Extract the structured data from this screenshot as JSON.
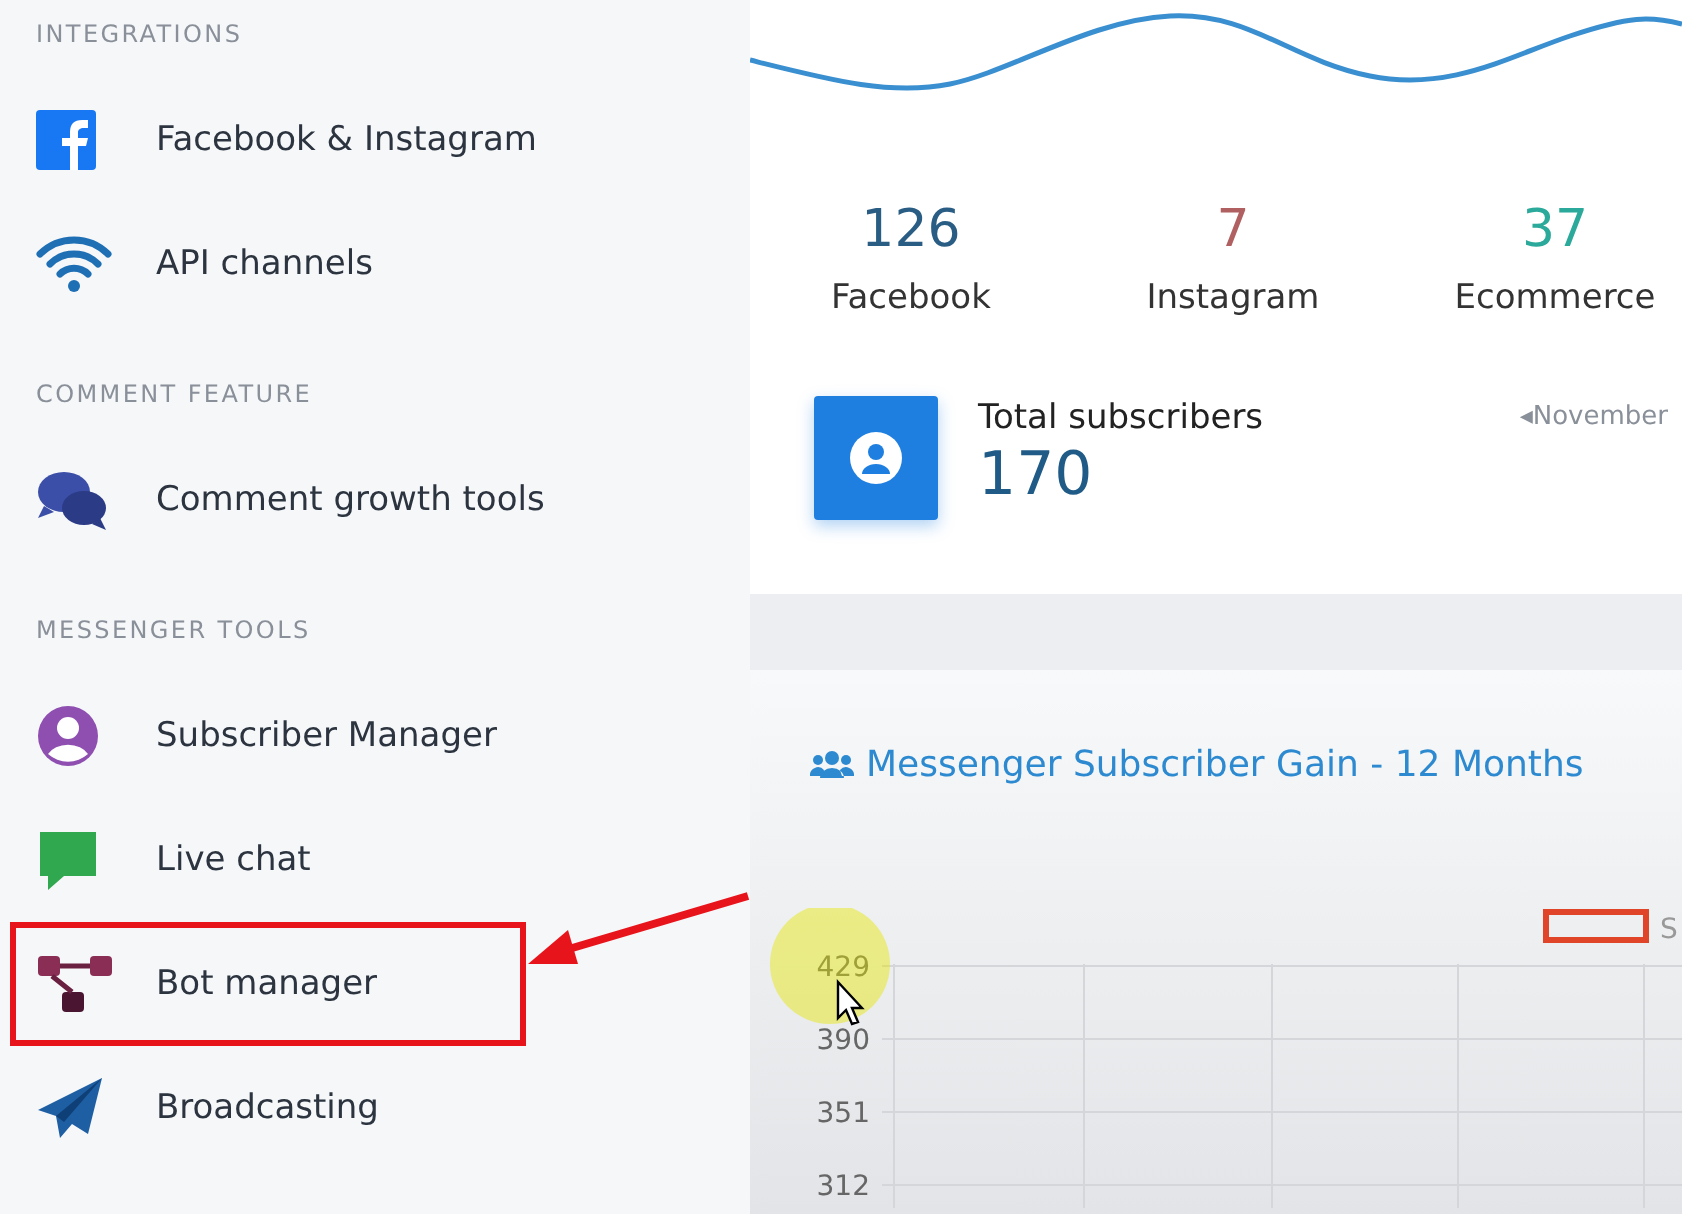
{
  "sidebar": {
    "sections": [
      {
        "title": "INTEGRATIONS",
        "items": [
          {
            "label": "Facebook & Instagram",
            "highlighted": false
          },
          {
            "label": "API channels",
            "highlighted": false
          }
        ]
      },
      {
        "title": "COMMENT FEATURE",
        "items": [
          {
            "label": "Comment growth tools",
            "highlighted": false
          }
        ]
      },
      {
        "title": "MESSENGER TOOLS",
        "items": [
          {
            "label": "Subscriber Manager",
            "highlighted": false
          },
          {
            "label": "Live chat",
            "highlighted": false
          },
          {
            "label": "Bot manager",
            "highlighted": true
          },
          {
            "label": "Broadcasting",
            "highlighted": false
          }
        ]
      }
    ]
  },
  "stats": [
    {
      "value": "126",
      "label": "Facebook",
      "color": "#2a5d84"
    },
    {
      "value": "7",
      "label": "Instagram",
      "color": "#b06060"
    },
    {
      "value": "37",
      "label": "Ecommerce",
      "color": "#2ba99a"
    }
  ],
  "total": {
    "label": "Total subscribers",
    "value": "170",
    "period": "◂November"
  },
  "chart": {
    "title": "Messenger Subscriber Gain - 12 Months",
    "legend_label": "S",
    "y_labels": [
      "429",
      "390",
      "351",
      "312"
    ]
  }
}
